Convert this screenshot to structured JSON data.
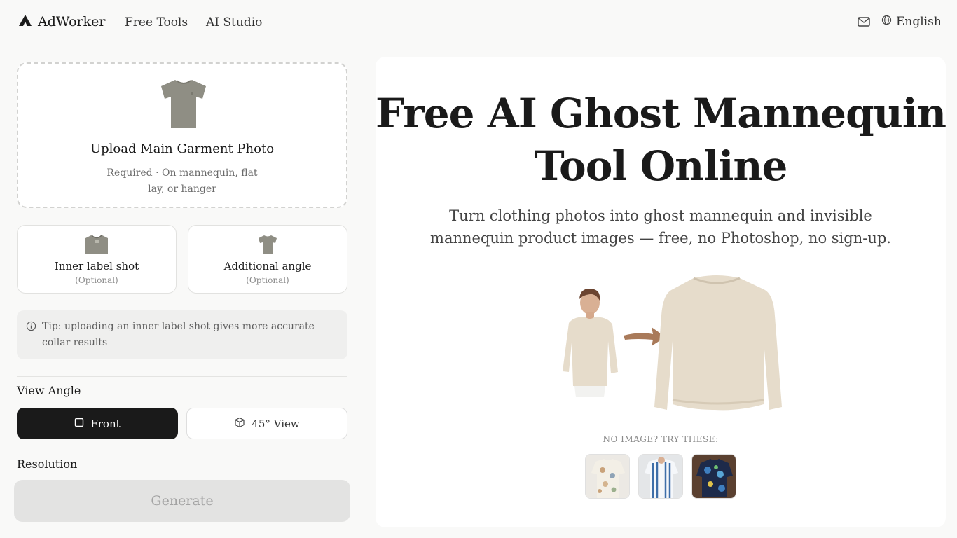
{
  "header": {
    "brand": "AdWorker",
    "nav": [
      "Free Tools",
      "AI Studio"
    ],
    "language": "English",
    "icons": {
      "logo": "triangle-logo-icon",
      "mail": "mail-icon",
      "globe": "globe-icon"
    }
  },
  "upload": {
    "title": "Upload Main Garment Photo",
    "subtitle": "Required · On mannequin, flat lay, or hanger"
  },
  "optional_uploads": [
    {
      "title": "Inner label shot",
      "subtitle": "(Optional)"
    },
    {
      "title": "Additional angle",
      "subtitle": "(Optional)"
    }
  ],
  "tip": "Tip: uploading an inner label shot gives more accurate collar results",
  "view_angle": {
    "label": "View Angle",
    "options": [
      "Front",
      "45° View"
    ],
    "selected": "Front"
  },
  "resolution": {
    "label": "Resolution"
  },
  "generate_label": "Generate",
  "hero": {
    "title": "Free AI Ghost Mannequin Tool Online",
    "subtitle": "Turn clothing photos into ghost mannequin and invisible mannequin product images — free, no Photoshop, no sign-up.",
    "try_label": "NO IMAGE? TRY THESE:"
  },
  "colors": {
    "accent_dark": "#1a1a1a",
    "garment": "#8f8e84",
    "sweater": "#e6dccb",
    "arrow": "#a97a5a"
  }
}
